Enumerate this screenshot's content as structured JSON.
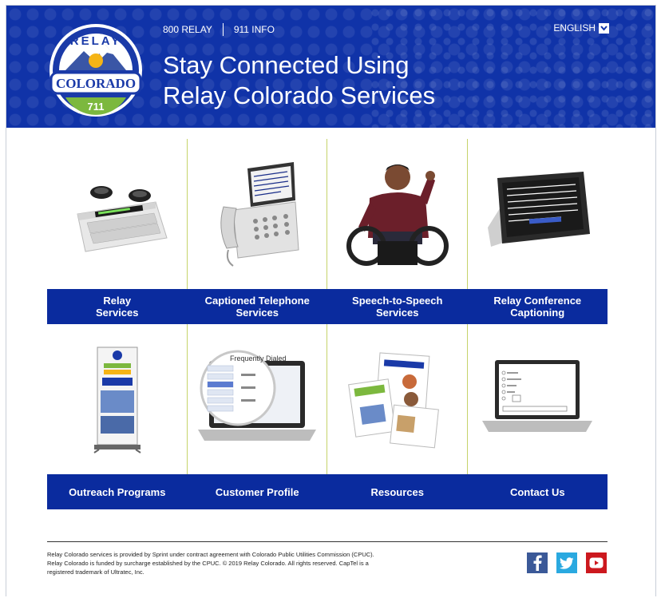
{
  "logo": {
    "top_text": "RELAY",
    "middle_text": "COLORADO",
    "bottom_text": "711"
  },
  "topnav": {
    "relay_800": "800 RELAY",
    "info_911": "911 INFO"
  },
  "language": {
    "selected": "ENGLISH"
  },
  "headline": {
    "line1": "Stay Connected Using",
    "line2": "Relay Colorado Services"
  },
  "tiles": [
    {
      "line1": "Relay",
      "line2": "Services",
      "icon": "teletypewriter-icon"
    },
    {
      "line1": "Captioned Telephone",
      "line2": "Services",
      "icon": "captioned-phone-icon"
    },
    {
      "line1": "Speech-to-Speech",
      "line2": "Services",
      "icon": "person-in-wheelchair-icon"
    },
    {
      "line1": "Relay Conference",
      "line2": "Captioning",
      "icon": "tablet-captioning-icon"
    },
    {
      "line1": "Outreach Programs",
      "line2": "",
      "icon": "banner-stand-icon"
    },
    {
      "line1": "Customer Profile",
      "line2": "",
      "icon": "laptop-magnifier-icon"
    },
    {
      "line1": "Resources",
      "line2": "",
      "icon": "brochures-icon"
    },
    {
      "line1": "Contact Us",
      "line2": "",
      "icon": "laptop-form-icon"
    }
  ],
  "footer": {
    "line1": "Relay Colorado services is provided by Sprint under contract agreement with Colorado Public Utilities Commission (CPUC).",
    "line2": "Relay Colorado is funded by surcharge established by the CPUC. © 2019 Relay Colorado. All rights reserved. CapTel is a",
    "line3": "registered trademark of Ultratec, Inc."
  },
  "social": {
    "facebook_color": "#3b5998",
    "twitter_color": "#2aa9e0",
    "youtube_color": "#cc181e"
  },
  "colors": {
    "header_bg": "#1033a8",
    "tile_label_bg": "#0a2b9e",
    "divider": "#c6d36a"
  }
}
